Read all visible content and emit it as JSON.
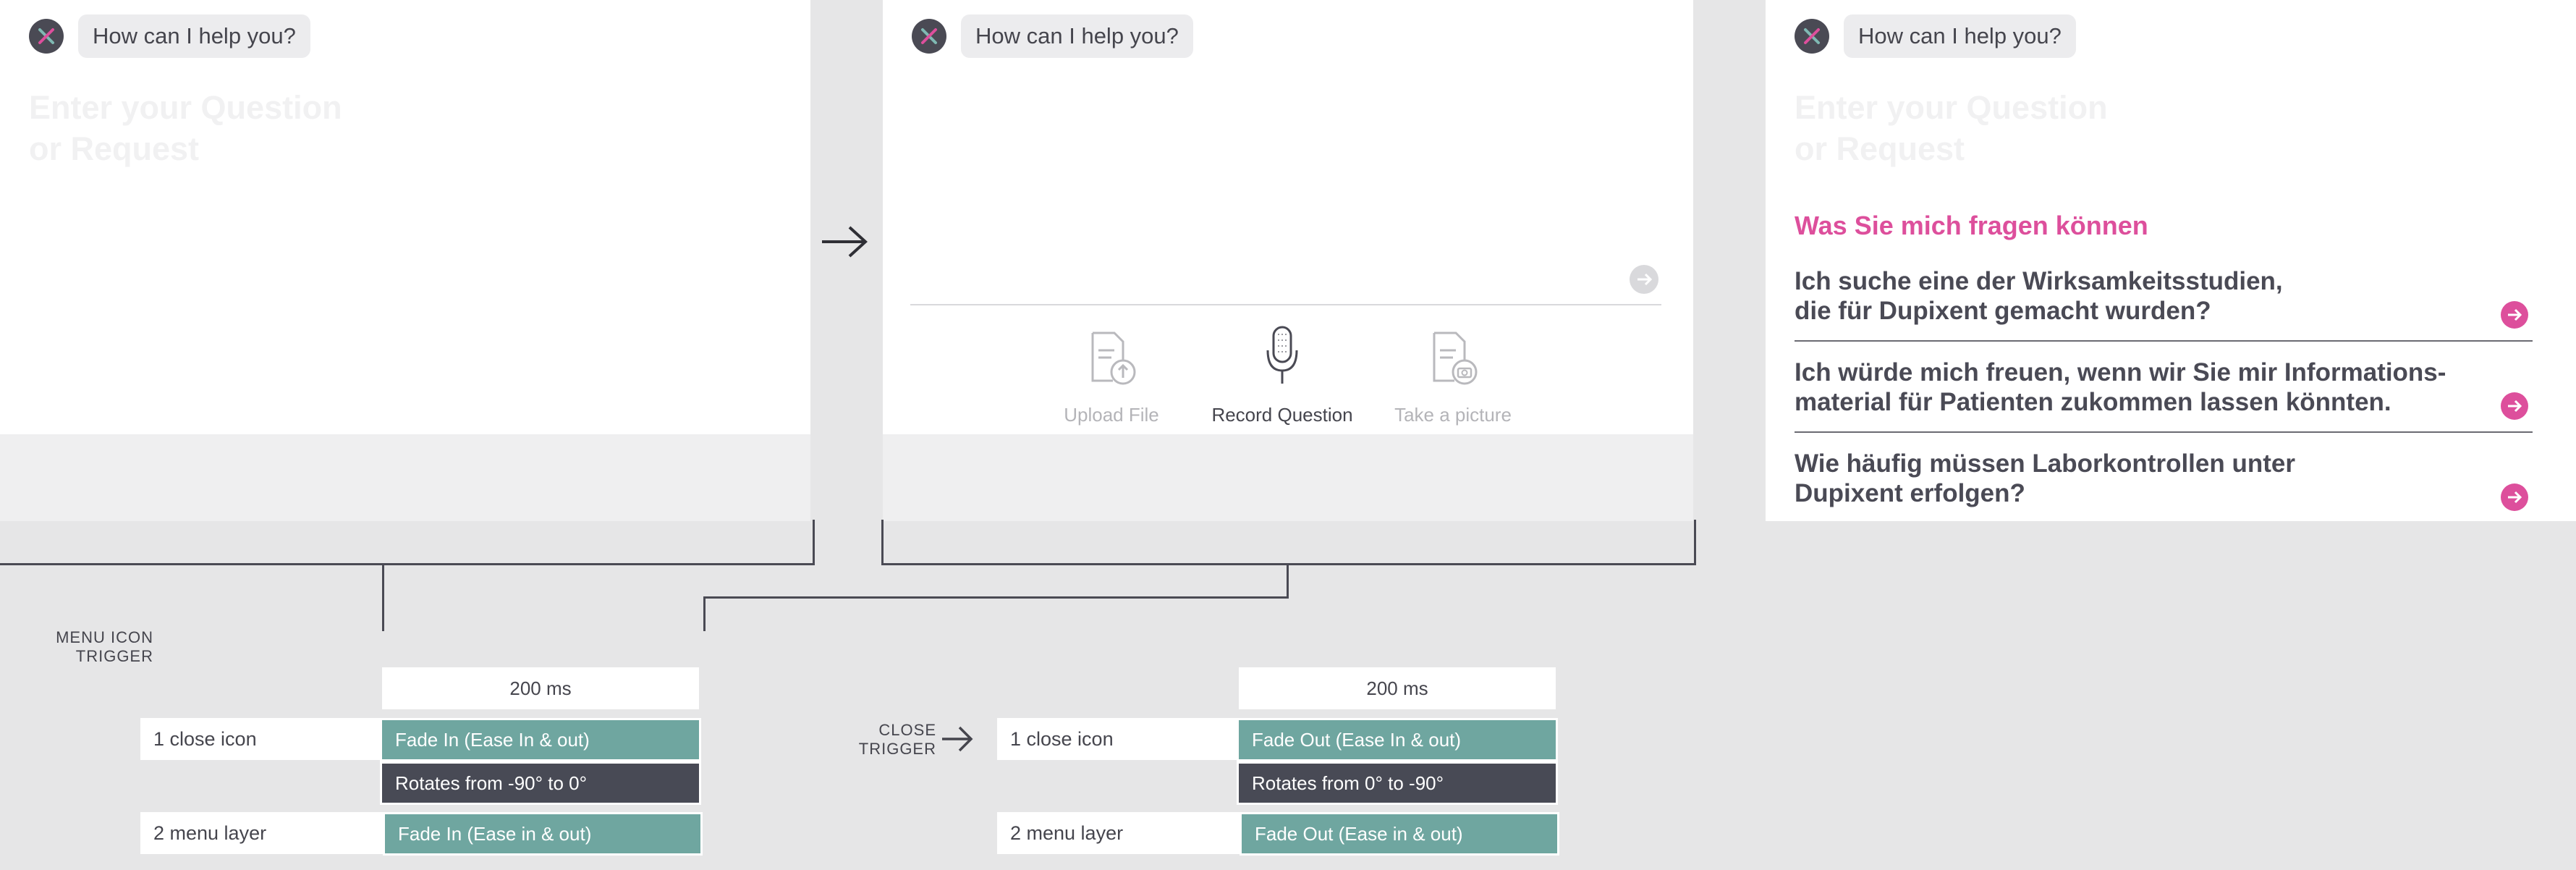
{
  "chat": {
    "greeting": "How can I help you?",
    "placeholder_line1": "Enter your Question",
    "placeholder_line2": "or Request"
  },
  "input_actions": [
    {
      "label": "Upload File",
      "icon": "upload-file-icon",
      "active": false
    },
    {
      "label": "Record Question",
      "icon": "microphone-icon",
      "active": true
    },
    {
      "label": "Take a picture",
      "icon": "camera-file-icon",
      "active": false
    }
  ],
  "suggestions": {
    "heading": "Was Sie mich fragen können",
    "items": [
      {
        "line1": "Ich suche eine der Wirksamkeitsstudien,",
        "line2": "die für Dupixent gemacht wurden?"
      },
      {
        "line1": "Ich würde mich freuen, wenn wir Sie mir Informations-",
        "line2": "material für Patienten zukommen lassen könnten."
      },
      {
        "line1": "Wie häufig müssen Laborkontrollen unter",
        "line2": "Dupixent erfolgen?"
      }
    ]
  },
  "spec_open": {
    "trigger_line1": "MENU ICON",
    "trigger_line2": "TRIGGER",
    "duration": "200 ms",
    "row1_label": "1 close icon",
    "row1_effect": "Fade In (Ease In &  out)",
    "row1_rotate": "Rotates from -90° to 0°",
    "row2_label": "2 menu layer",
    "row2_effect": "Fade In (Ease in & out)"
  },
  "spec_close": {
    "trigger_line1": "CLOSE",
    "trigger_line2": "TRIGGER",
    "duration": "200 ms",
    "row1_label": "1 close icon",
    "row1_effect": "Fade Out (Ease In &  out)",
    "row1_rotate": "Rotates from 0° to -90°",
    "row2_label": "2 menu layer",
    "row2_effect": "Fade Out (Ease in & out)"
  },
  "colors": {
    "accent_pink": "#dd4f9c",
    "teal": "#6fa6a0",
    "dark": "#484a55",
    "text": "#45454d",
    "background": "#e6e6e7"
  }
}
